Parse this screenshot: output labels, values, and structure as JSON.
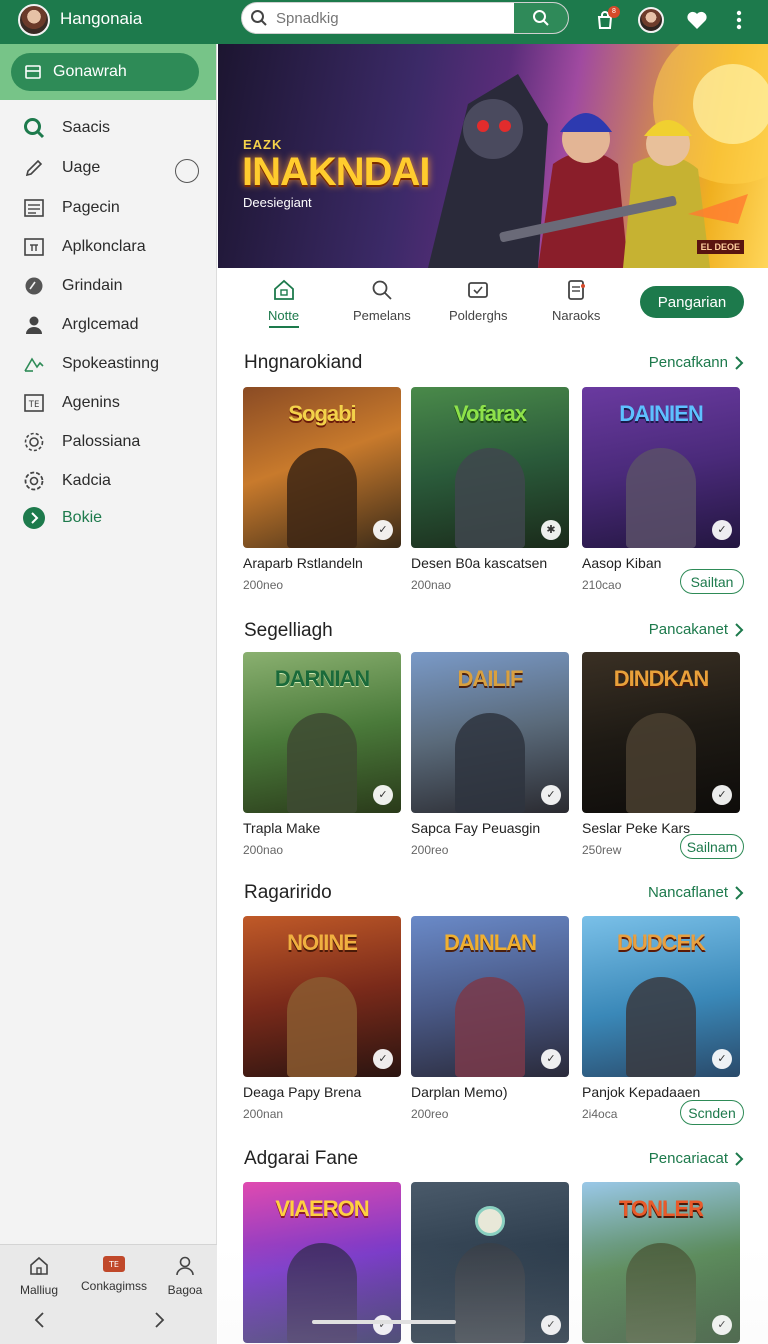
{
  "header": {
    "app_title": "Hangonaia",
    "search_placeholder": "Spnadkig",
    "notification_count": "8"
  },
  "sidebar": {
    "active_label": "Gonawrah",
    "items": [
      {
        "label": "Saacis",
        "icon": "search-icon"
      },
      {
        "label": "Uage",
        "icon": "pencil-icon"
      },
      {
        "label": "Pagecin",
        "icon": "document-icon"
      },
      {
        "label": "Aplkonclara",
        "icon": "calendar-icon"
      },
      {
        "label": "Grindain",
        "icon": "disc-icon"
      },
      {
        "label": "Arglcemad",
        "icon": "user-icon"
      },
      {
        "label": "Spokeastinng",
        "icon": "signal-icon"
      },
      {
        "label": "Agenins",
        "icon": "tag-icon"
      },
      {
        "label": "Palossiana",
        "icon": "gear-icon"
      },
      {
        "label": "Kadcia",
        "icon": "settings-icon"
      },
      {
        "label": "Bokie",
        "icon": "chevron-right-icon"
      }
    ],
    "bottom_nav": [
      {
        "label": "Malliug",
        "icon": "home-icon"
      },
      {
        "label": "Conkagimss",
        "icon": "gamepad-icon"
      },
      {
        "label": "Bagoa",
        "icon": "profile-icon"
      }
    ]
  },
  "hero": {
    "small": "EAZK",
    "title": "INAKNDAI",
    "subtitle": "Deesiegiant",
    "tag": "EL DEOE"
  },
  "tabs": [
    {
      "label": "Notte",
      "icon": "home-icon"
    },
    {
      "label": "Pemelans",
      "icon": "search-icon"
    },
    {
      "label": "Polderghs",
      "icon": "controller-icon"
    },
    {
      "label": "Naraoks",
      "icon": "clipboard-icon"
    }
  ],
  "tab_button": "Pangarian",
  "sections": [
    {
      "title": "Hngnarokiand",
      "more": "Pencafkann",
      "cards": [
        {
          "name": "Araparb Rstlandeln",
          "meta": "200neo",
          "logo": "Sogabi"
        },
        {
          "name": "Desen B0a kascatsen",
          "meta": "200nao",
          "logo": "Vofarax"
        },
        {
          "name": "Aasop Kiban",
          "meta": "210cao",
          "logo": "DAINIEN"
        }
      ],
      "button": "Sailtan"
    },
    {
      "title": "Segelliagh",
      "more": "Pancakanet",
      "cards": [
        {
          "name": "Trapla Make",
          "meta": "200nao",
          "logo": "DARNIAN"
        },
        {
          "name": "Sapca Fay Peuasgin",
          "meta": "200reo",
          "logo": "DAILIF"
        },
        {
          "name": "Seslar Peke Kars",
          "meta": "250rew",
          "logo": "DINDKAN"
        }
      ],
      "button": "Sailnam"
    },
    {
      "title": "Ragarirido",
      "more": "Nancaflanet",
      "cards": [
        {
          "name": "Deaga Papy Brena",
          "meta": "200nan",
          "logo": "NOIINE"
        },
        {
          "name": "Darplan Memo)",
          "meta": "200reo",
          "logo": "DAINLAN"
        },
        {
          "name": "Panjok Kepadaaen",
          "meta": "2i4oca",
          "logo": "DUDCEK"
        }
      ],
      "button": "Scnden"
    },
    {
      "title": "Adgarai Fane",
      "more": "Pencariacat",
      "cards": [
        {
          "name": "",
          "meta": "",
          "logo": "VIAERON"
        },
        {
          "name": "",
          "meta": "",
          "logo": ""
        },
        {
          "name": "",
          "meta": "",
          "logo": "TONLER"
        }
      ]
    }
  ],
  "colors": {
    "brand": "#1d7a4c",
    "sidebar_header": "#77c488",
    "accent": "#2e8b57"
  }
}
